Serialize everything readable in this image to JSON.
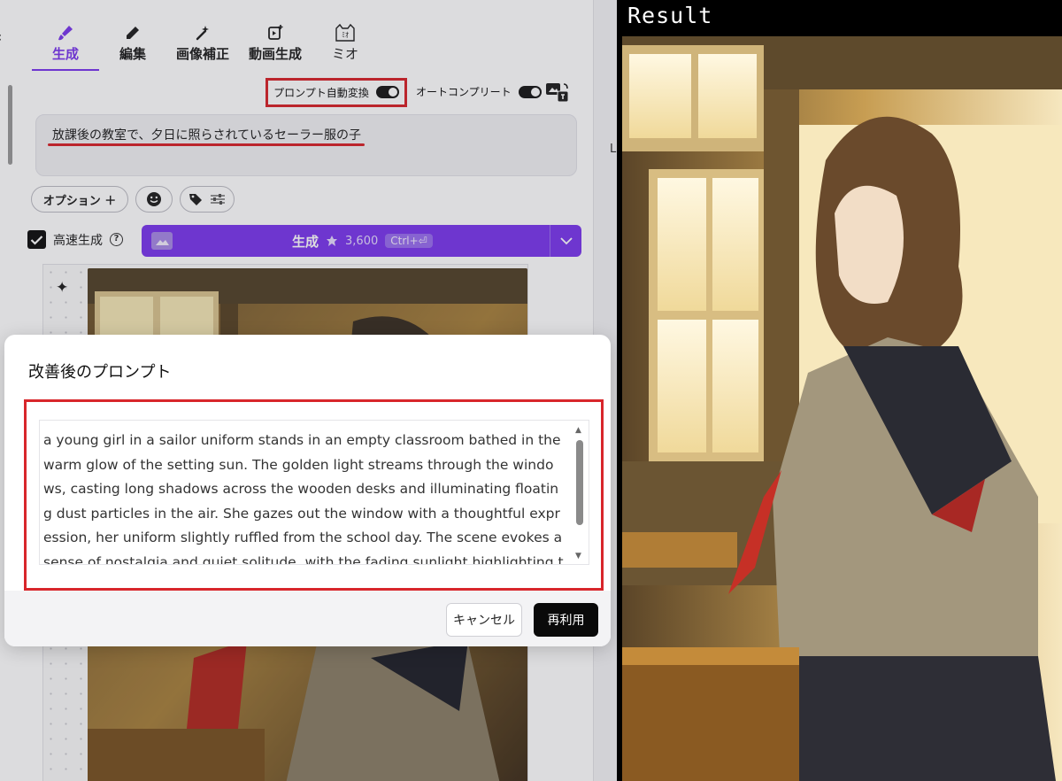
{
  "tabs": [
    {
      "label": "生成",
      "icon": "brush-icon",
      "active": true
    },
    {
      "label": "編集",
      "icon": "pencil-icon",
      "active": false
    },
    {
      "label": "画像補正",
      "icon": "magic-wand-icon",
      "active": false
    },
    {
      "label": "動画生成",
      "icon": "video-plus-icon",
      "active": false
    },
    {
      "label": "ミオ",
      "icon": "cat-face-icon",
      "active": false
    }
  ],
  "mio_icon_text": "ﾐｵ",
  "toggles": {
    "prompt_auto_convert": {
      "label": "プロンプト自動変換",
      "on": true
    },
    "autocomplete": {
      "label": "オートコンプリート",
      "on": true
    }
  },
  "prompt": {
    "value": "放課後の教室で、夕日に照らされているセーラー服の子"
  },
  "chips": {
    "options_label": "オプション ＋"
  },
  "fast_generation": {
    "label": "高速生成",
    "checked": true,
    "help": "?"
  },
  "generate_button": {
    "label": "生成",
    "cost": "3,600",
    "shortcut": "Ctrl+⏎"
  },
  "modal": {
    "title": "改善後のプロンプト",
    "text": "a young girl in a sailor uniform stands in an empty classroom bathed in the warm glow of the setting sun. The golden light streams through the windows, casting long shadows across the wooden desks and illuminating floating dust particles in the air. She gazes out the window with a thoughtful expression, her uniform slightly ruffled from the school day. The scene evokes a sense of nostalgia and quiet solitude, with the fading sunlight highlighting the texture",
    "cancel_label": "キャンセル",
    "reuse_label": "再利用"
  },
  "right_strip_fragment": "L",
  "result": {
    "label": "Result"
  },
  "colors": {
    "accent": "#7c3aed",
    "highlight_red": "#d8262b",
    "result_bg": "#000000"
  }
}
